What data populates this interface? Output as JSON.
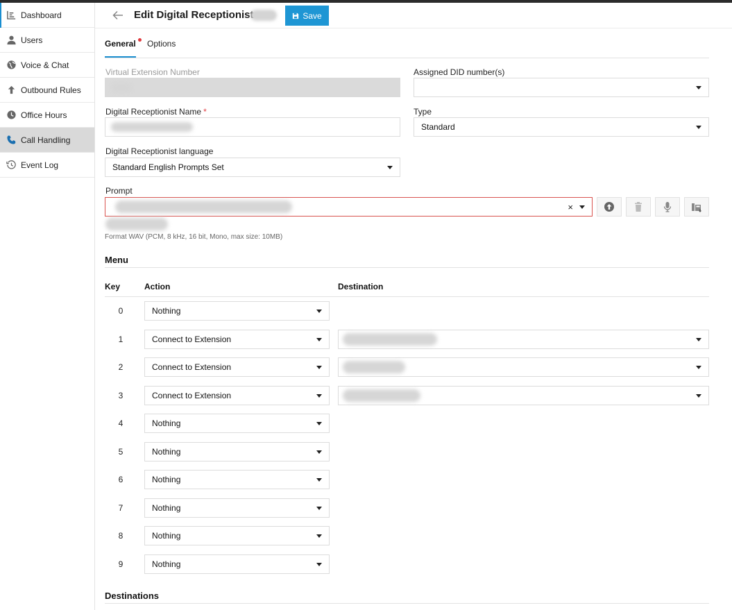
{
  "sidebar": {
    "items": [
      {
        "label": "Dashboard",
        "icon": "dashboard-icon"
      },
      {
        "label": "Users",
        "icon": "user-icon"
      },
      {
        "label": "Voice & Chat",
        "icon": "globe-icon"
      },
      {
        "label": "Outbound Rules",
        "icon": "arrow-up-icon"
      },
      {
        "label": "Office Hours",
        "icon": "clock-icon"
      },
      {
        "label": "Call Handling",
        "icon": "phone-icon"
      },
      {
        "label": "Event Log",
        "icon": "history-icon"
      }
    ],
    "active": "Call Handling"
  },
  "header": {
    "title": "Edit Digital Receptionist",
    "save_label": "Save"
  },
  "tabs": [
    {
      "label": "General"
    },
    {
      "label": "Options"
    }
  ],
  "form": {
    "virtual_extension_label": "Virtual Extension Number",
    "assigned_did_label": "Assigned DID number(s)",
    "assigned_did_value": "",
    "name_label": "Digital Receptionist Name",
    "name_required": "*",
    "type_label": "Type",
    "type_value": "Standard",
    "language_label": "Digital Receptionist language",
    "language_value": "Standard English Prompts Set",
    "prompt_label": "Prompt",
    "prompt_clear": "×",
    "format_hint": "Format WAV (PCM, 8 kHz, 16 bit, Mono, max size: 10MB)"
  },
  "menu": {
    "title": "Menu",
    "col_key": "Key",
    "col_action": "Action",
    "col_destination": "Destination",
    "rows": [
      {
        "key": "0",
        "action": "Nothing"
      },
      {
        "key": "1",
        "action": "Connect to Extension"
      },
      {
        "key": "2",
        "action": "Connect to Extension"
      },
      {
        "key": "3",
        "action": "Connect to Extension"
      },
      {
        "key": "4",
        "action": "Nothing"
      },
      {
        "key": "5",
        "action": "Nothing"
      },
      {
        "key": "6",
        "action": "Nothing"
      },
      {
        "key": "7",
        "action": "Nothing"
      },
      {
        "key": "8",
        "action": "Nothing"
      },
      {
        "key": "9",
        "action": "Nothing"
      }
    ]
  },
  "destinations_title": "Destinations",
  "colors": {
    "accent": "#1e96d4",
    "error": "#d9534f",
    "active_nav": "#d9d9d9"
  }
}
